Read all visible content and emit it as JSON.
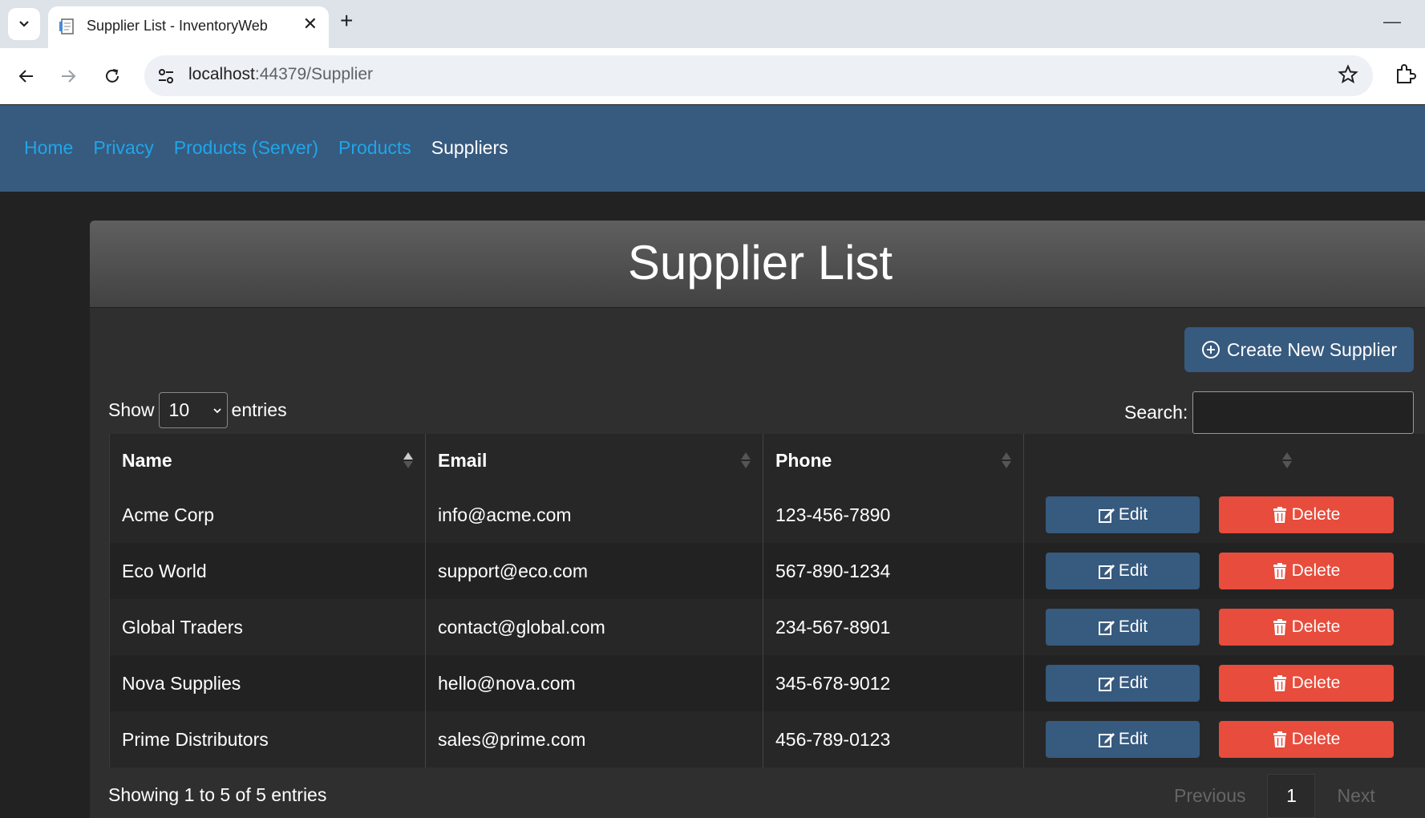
{
  "browser": {
    "tab_title": "Supplier List - InventoryWeb",
    "url_host": "localhost",
    "url_rest": ":44379/Supplier"
  },
  "navbar": {
    "links": [
      "Home",
      "Privacy",
      "Products (Server)",
      "Products",
      "Suppliers"
    ],
    "active": "Suppliers"
  },
  "page": {
    "title": "Supplier List",
    "create_label": "Create New Supplier",
    "show_label": "Show",
    "entries_label": "entries",
    "page_length": "10",
    "search_label": "Search:",
    "search_value": "",
    "info": "Showing 1 to 5 of 5 entries",
    "prev_label": "Previous",
    "next_label": "Next",
    "current_page": "1"
  },
  "table": {
    "columns": [
      "Name",
      "Email",
      "Phone",
      ""
    ],
    "edit_label": "Edit",
    "delete_label": "Delete",
    "rows": [
      {
        "name": "Acme Corp",
        "email": "info@acme.com",
        "phone": "123-456-7890"
      },
      {
        "name": "Eco World",
        "email": "support@eco.com",
        "phone": "567-890-1234"
      },
      {
        "name": "Global Traders",
        "email": "contact@global.com",
        "phone": "234-567-8901"
      },
      {
        "name": "Nova Supplies",
        "email": "hello@nova.com",
        "phone": "345-678-9012"
      },
      {
        "name": "Prime Distributors",
        "email": "sales@prime.com",
        "phone": "456-789-0123"
      }
    ]
  },
  "colors": {
    "navbar": "#375a7f",
    "link": "#1fa6e8",
    "danger": "#e74c3c"
  }
}
